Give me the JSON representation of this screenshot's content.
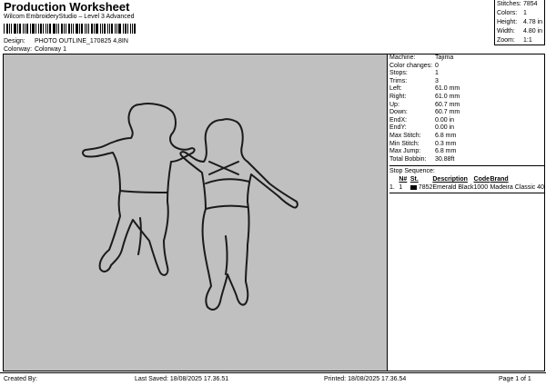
{
  "header": {
    "title": "Production Worksheet",
    "subtitle": "Wilcom EmbroideryStudio – Level 3 Advanced",
    "design_label": "Design:",
    "design_value": "PHOTO OUTLINE_170825 4,8IN",
    "colorway_label": "Colorway:",
    "colorway_value": "Colorway 1"
  },
  "summary": [
    {
      "label": "Stitches:",
      "value": "7854"
    },
    {
      "label": "Colors:",
      "value": "1"
    },
    {
      "label": "Height:",
      "value": "4.78 in"
    },
    {
      "label": "Width:",
      "value": "4.80 in"
    },
    {
      "label": "Zoom:",
      "value": "1:1"
    }
  ],
  "machine_info": [
    {
      "label": "Machine:",
      "value": "Tajima"
    },
    {
      "label": "Color changes:",
      "value": "0"
    },
    {
      "label": "Stops:",
      "value": "1"
    },
    {
      "label": "Trims:",
      "value": "3"
    },
    {
      "label": "Left:",
      "value": "61.0 mm"
    },
    {
      "label": "Right:",
      "value": "61.0 mm"
    },
    {
      "label": "Up:",
      "value": "60.7 mm"
    },
    {
      "label": "Down:",
      "value": "60.7 mm"
    },
    {
      "label": "EndX:",
      "value": "0.00 in"
    },
    {
      "label": "EndY:",
      "value": "0.00 in"
    },
    {
      "label": "Max Stitch:",
      "value": "6.8 mm"
    },
    {
      "label": "Min Stitch:",
      "value": "0.3 mm"
    },
    {
      "label": "Max Jump:",
      "value": "6.8 mm"
    },
    {
      "label": "Total Bobbin:",
      "value": "30.88ft"
    }
  ],
  "stop_sequence": {
    "title": "Stop Sequence:",
    "headers": [
      "N#",
      "St.",
      "Description",
      "Code",
      "Brand"
    ],
    "rows": [
      {
        "index": "1.",
        "n": "1",
        "color": "#000000",
        "stitches": "7852",
        "description": "Emerald Black",
        "code": "1000",
        "brand": "Madeira Classic 40"
      }
    ]
  },
  "footer": {
    "created_by": "Created By:",
    "last_saved": "Last Saved: 18/08/2025 17.36.51",
    "printed": "Printed: 18/08/2025 17.36.54",
    "page": "Page 1 of 1"
  },
  "colors": {
    "design_background": "#c0c0c0",
    "thread": "#1a1a1a"
  }
}
